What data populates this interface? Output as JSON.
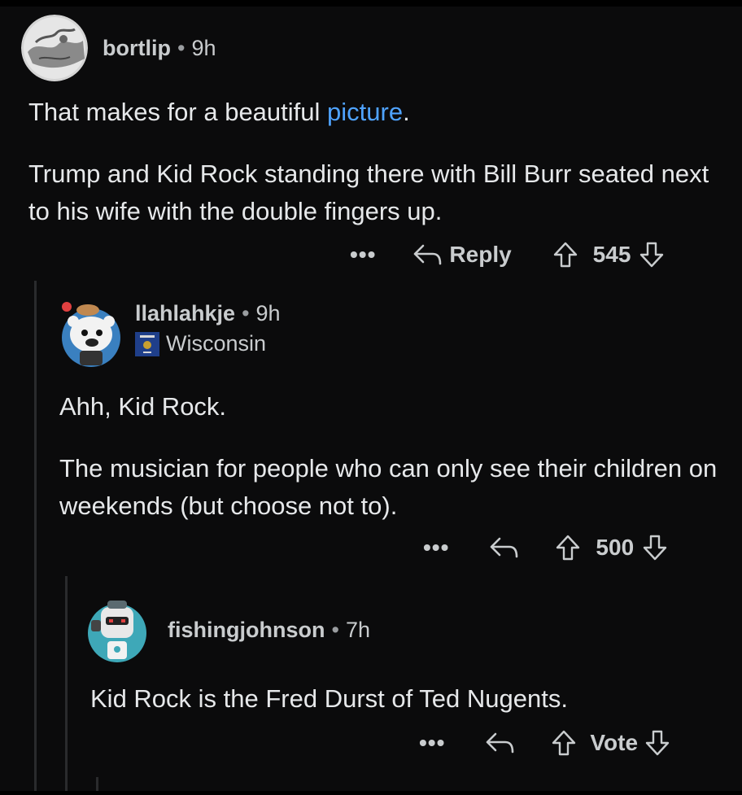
{
  "comments": [
    {
      "username": "bortlip",
      "time": "9h",
      "text_1_prefix": "That makes for a beautiful ",
      "text_1_link": "picture",
      "text_1_suffix": ".",
      "text_2": "Trump and Kid Rock standing there with Bill Burr seated next to his wife with the double fingers up.",
      "reply_label": "Reply",
      "votes": "545"
    },
    {
      "username": "llahlahkje",
      "time": "9h",
      "flair": "Wisconsin",
      "text_1": "Ahh, Kid Rock.",
      "text_2": "The musician for people who can only see their children on weekends (but choose not to).",
      "votes": "500"
    },
    {
      "username": "fishingjohnson",
      "time": "7h",
      "text_1": "Kid Rock is the Fred Durst of Ted Nugents.",
      "votes": "Vote"
    }
  ],
  "icons": {
    "more": "more-options-icon",
    "reply": "reply-arrow-icon",
    "upvote": "upvote-arrow-icon",
    "downvote": "downvote-arrow-icon"
  },
  "colors": {
    "background": "#0b0b0c",
    "text": "#e6e8ea",
    "link": "#4fa3ff",
    "meta": "#c9ccce"
  }
}
